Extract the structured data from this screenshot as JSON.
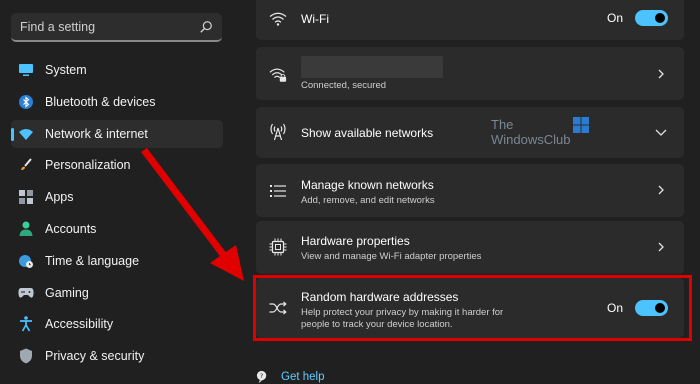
{
  "search": {
    "placeholder": "Find a setting"
  },
  "sidebar": {
    "items": [
      {
        "label": "System",
        "icon": "monitor-icon",
        "color": "#4cc2ff"
      },
      {
        "label": "Bluetooth & devices",
        "icon": "bluetooth-icon",
        "color": "#4cc2ff"
      },
      {
        "label": "Network & internet",
        "icon": "wifi-icon",
        "color": "#4cc2ff",
        "active": true
      },
      {
        "label": "Personalization",
        "icon": "brush-icon",
        "color": "#f0a23c"
      },
      {
        "label": "Apps",
        "icon": "apps-icon",
        "color": "#bfc7d1"
      },
      {
        "label": "Accounts",
        "icon": "person-icon",
        "color": "#3ccf9a"
      },
      {
        "label": "Time & language",
        "icon": "globe-clock-icon",
        "color": "#4cc2ff"
      },
      {
        "label": "Gaming",
        "icon": "gamepad-icon",
        "color": "#bfc7d1"
      },
      {
        "label": "Accessibility",
        "icon": "accessibility-icon",
        "color": "#4cc2ff"
      },
      {
        "label": "Privacy & security",
        "icon": "shield-icon",
        "color": "#a0a8b2"
      }
    ]
  },
  "main": {
    "wifi": {
      "title": "Wi-Fi",
      "toggle_label": "On",
      "toggle_on": true
    },
    "network": {
      "status": "Connected, secured"
    },
    "available": {
      "title": "Show available networks"
    },
    "known": {
      "title": "Manage known networks",
      "sub": "Add, remove, and edit networks"
    },
    "hardware": {
      "title": "Hardware properties",
      "sub": "View and manage Wi-Fi adapter properties"
    },
    "random": {
      "title": "Random hardware addresses",
      "sub1": "Help protect your privacy by making it harder for",
      "sub2": "people to track your device location.",
      "toggle_label": "On",
      "toggle_on": true
    },
    "help": {
      "label": "Get help"
    }
  },
  "watermark": {
    "line1": "The",
    "line2": "WindowsClub"
  },
  "colors": {
    "accent": "#4cc2ff",
    "highlight": "#e00000",
    "card": "#2b2b2b",
    "bg": "#202020"
  }
}
